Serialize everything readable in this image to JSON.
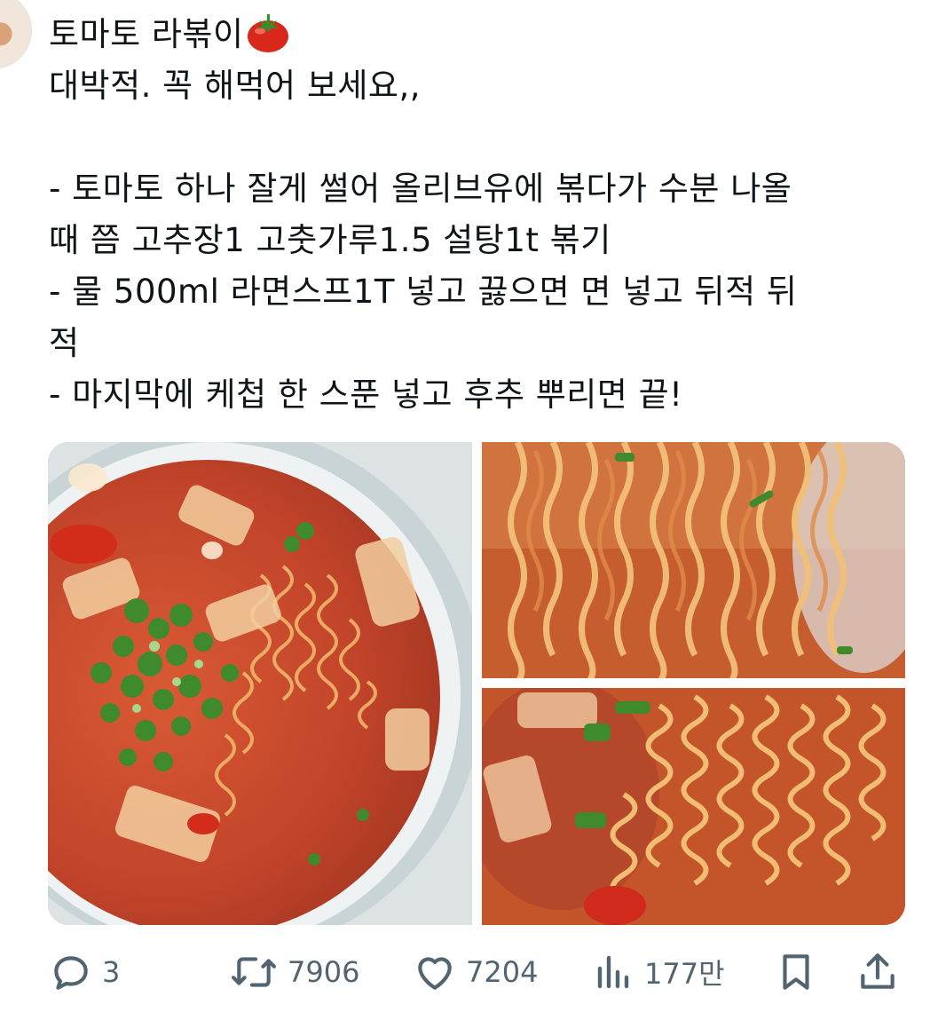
{
  "tweet": {
    "lines": [
      "토마토 라볶이",
      "대박적. 꼭 해먹어 보세요,,",
      "",
      "- 토마토 하나 잘게 썰어 올리브유에 볶다가 수분 나올",
      "때 쯤 고추장1 고춧가루1.5 설탕1t 볶기",
      "- 물 500ml 라면스프1T 넣고 끓으면 면 넣고 뒤적 뒤",
      "적",
      "- 마지막에 케첩 한 스푼 넣고 후추 뿌리면 끝!"
    ],
    "emoji": "tomato-emoji"
  },
  "actions": {
    "reply_count": "3",
    "retweet_count": "7906",
    "like_count": "7204",
    "views_count": "177만"
  },
  "colors": {
    "text": "#0f1419",
    "muted": "#536471",
    "sauce": "#c0432a",
    "scallion": "#3f8a2c",
    "noodle": "#e9a75e"
  }
}
